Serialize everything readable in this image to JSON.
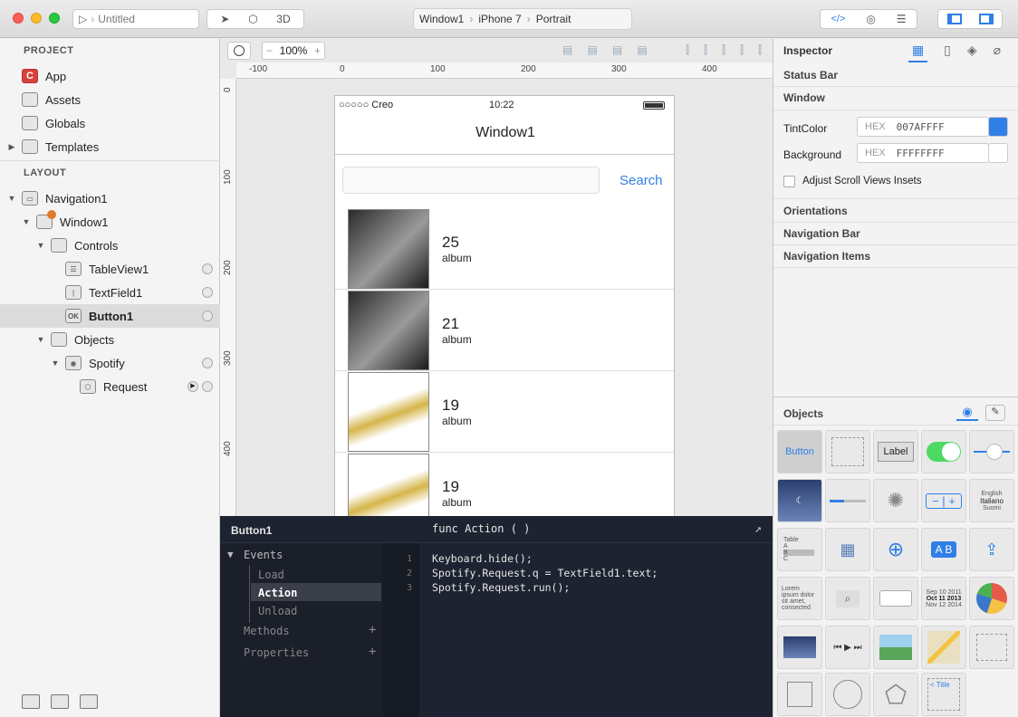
{
  "titlebar": {
    "doc_title": "Untitled",
    "btn_3d": "3D",
    "breadcrumb": [
      "Window1",
      "iPhone 7",
      "Portrait"
    ],
    "code_btn": "</>"
  },
  "sidebar": {
    "project_header": "PROJECT",
    "project_items": [
      {
        "label": "App",
        "icon": "creo-app-icon"
      },
      {
        "label": "Assets",
        "icon": "assets-folder-icon"
      },
      {
        "label": "Globals",
        "icon": "globals-folder-icon"
      },
      {
        "label": "Templates",
        "icon": "templates-folder-icon"
      }
    ],
    "layout_header": "LAYOUT",
    "layout_items": [
      {
        "label": "Navigation1",
        "icon": "navigation-icon"
      },
      {
        "label": "Window1",
        "icon": "window-icon"
      },
      {
        "label": "Controls",
        "icon": "folder-icon"
      },
      {
        "label": "TableView1",
        "icon": "tableview-icon"
      },
      {
        "label": "TextField1",
        "icon": "textfield-icon"
      },
      {
        "label": "Button1",
        "icon": "button-icon",
        "icon_text": "OK"
      },
      {
        "label": "Objects",
        "icon": "folder-icon"
      },
      {
        "label": "Spotify",
        "icon": "spotify-object-icon"
      },
      {
        "label": "Request",
        "icon": "request-cube-icon"
      }
    ]
  },
  "canvas": {
    "zoom": "100%",
    "ruler_x": [
      "-100",
      "0",
      "100",
      "200",
      "300",
      "400"
    ],
    "ruler_y": [
      "0",
      "100",
      "200",
      "300",
      "400"
    ]
  },
  "phone": {
    "carrier": "○○○○○ Creo",
    "time": "10:22",
    "title": "Window1",
    "search_btn": "Search",
    "rows": [
      {
        "count": "25",
        "label": "album"
      },
      {
        "count": "21",
        "label": "album"
      },
      {
        "count": "19",
        "label": "album"
      },
      {
        "count": "19",
        "label": "album"
      }
    ]
  },
  "code": {
    "object": "Button1",
    "signature": "func Action ( )",
    "events_label": "Events",
    "events": [
      "Load",
      "Action",
      "Unload"
    ],
    "selected_event": "Action",
    "methods_label": "Methods",
    "properties_label": "Properties",
    "line_numbers": [
      "1",
      "2",
      "3"
    ],
    "lines": [
      "Keyboard.hide();",
      "Spotify.Request.q = TextField1.text;",
      "Spotify.Request.run();"
    ]
  },
  "inspector": {
    "title": "Inspector",
    "status_bar": "Status Bar",
    "window": "Window",
    "tint_label": "TintColor",
    "hex_label": "HEX",
    "tint_value": "007AFFFF",
    "tint_color": "#2f7fe6",
    "bg_label": "Background",
    "bg_value": "FFFFFFFF",
    "bg_color": "#ffffff",
    "adjust_label": "Adjust Scroll Views Insets",
    "orientations": "Orientations",
    "nav_bar": "Navigation Bar",
    "nav_items": "Navigation Items"
  },
  "objects": {
    "title": "Objects",
    "button_label": "Button",
    "label_label": "Label",
    "table_rows": [
      "Table",
      "A",
      "B",
      "C"
    ],
    "picker_rows": [
      "English",
      "Italiano",
      "Suomi"
    ],
    "lorem": "Lorem ipsum dolor sit amet, consected",
    "dates": [
      "Sep 10 2011",
      "Oct 11 2013",
      "Nov 12 2014"
    ],
    "ab": "A B",
    "nav_title": "< Title"
  }
}
